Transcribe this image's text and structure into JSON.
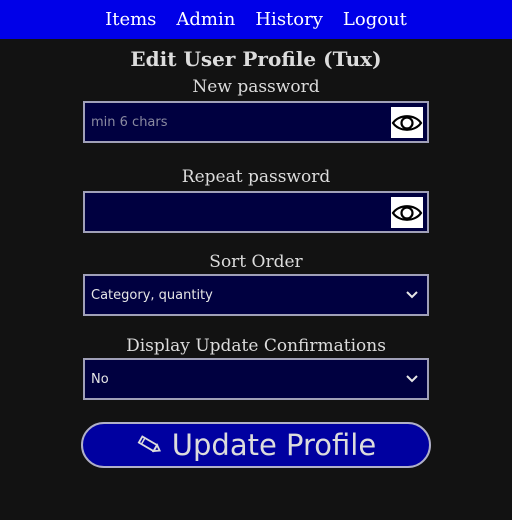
{
  "nav": {
    "items": [
      "Items",
      "Admin",
      "History",
      "Logout"
    ]
  },
  "page": {
    "title": "Edit User Profile (Tux)"
  },
  "form": {
    "new_password_label": "New password",
    "new_password_placeholder": "min 6 chars",
    "repeat_password_label": "Repeat password",
    "sort_order_label": "Sort Order",
    "sort_order_value": "Category, quantity",
    "confirmations_label": "Display Update Confirmations",
    "confirmations_value": "No",
    "submit_label": "Update Profile"
  },
  "icons": {
    "eye": "eye-icon",
    "chevron": "chevron-down-icon",
    "pencil": "pencil-icon"
  },
  "colors": {
    "nav_bg": "#0000e8",
    "field_bg": "#000040",
    "button_bg": "#0000a0",
    "page_bg": "#121212"
  }
}
